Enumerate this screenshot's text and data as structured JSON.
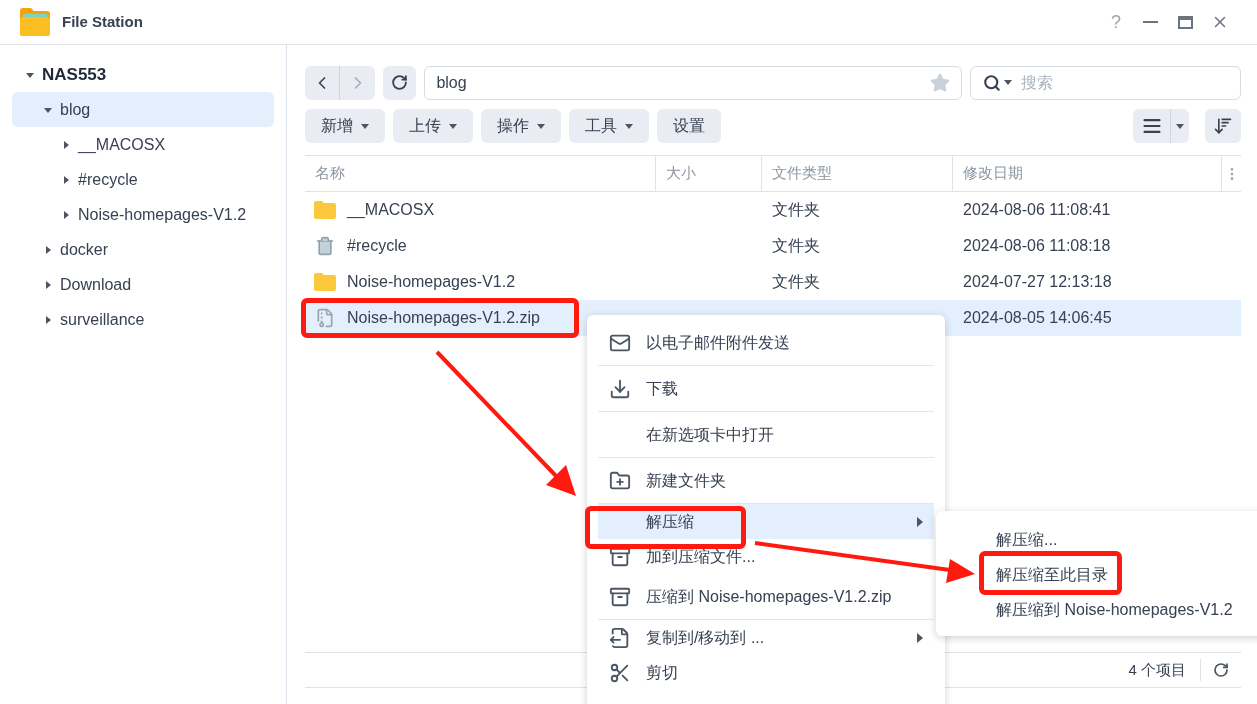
{
  "window": {
    "title": "File Station",
    "help": "?"
  },
  "sidebar": {
    "tree": [
      {
        "label": "NAS553",
        "expanded": true,
        "selected": false,
        "children": [
          {
            "label": "blog",
            "expanded": true,
            "selected": true,
            "children": [
              {
                "label": "__MACOSX",
                "expanded": false,
                "selected": false
              },
              {
                "label": "#recycle",
                "expanded": false,
                "selected": false
              },
              {
                "label": "Noise-homepages-V1.2",
                "expanded": false,
                "selected": false
              }
            ]
          },
          {
            "label": "docker",
            "expanded": false,
            "selected": false
          },
          {
            "label": "Download",
            "expanded": false,
            "selected": false
          },
          {
            "label": "surveillance",
            "expanded": false,
            "selected": false
          }
        ]
      }
    ]
  },
  "path": {
    "value": "blog",
    "starred": false
  },
  "search": {
    "placeholder": "搜索"
  },
  "toolbar": [
    {
      "label": "新增",
      "has_menu": true
    },
    {
      "label": "上传",
      "has_menu": true
    },
    {
      "label": "操作",
      "has_menu": true
    },
    {
      "label": "工具",
      "has_menu": true
    },
    {
      "label": "设置",
      "has_menu": false
    }
  ],
  "table": {
    "columns": [
      "名称",
      "大小",
      "文件类型",
      "修改日期"
    ],
    "rows": [
      {
        "kind": "folder",
        "name": "__MACOSX",
        "type": "文件夹",
        "modified": "2024-08-06 11:08:41",
        "selected": false
      },
      {
        "kind": "trash",
        "name": "#recycle",
        "type": "文件夹",
        "modified": "2024-08-06 11:08:18",
        "selected": false
      },
      {
        "kind": "folder",
        "name": "Noise-homepages-V1.2",
        "type": "文件夹",
        "modified": "2024-07-27 12:13:18",
        "selected": false
      },
      {
        "kind": "zip",
        "name": "Noise-homepages-V1.2.zip",
        "modified": "2024-08-05 14:06:45",
        "selected": true
      }
    ]
  },
  "status_bar": {
    "count": "4 个项目"
  },
  "context_menu": [
    {
      "kind": "mail",
      "label": "以电子邮件附件发送",
      "divider_after": true,
      "submenu": false,
      "highlighted": false
    },
    {
      "kind": "download",
      "label": "下载",
      "divider_after": true,
      "submenu": false,
      "highlighted": false
    },
    {
      "kind": "none",
      "label": "在新选项卡中打开",
      "divider_after": true,
      "submenu": false,
      "highlighted": false
    },
    {
      "kind": "new-folder",
      "label": "新建文件夹",
      "divider_after": true,
      "submenu": false,
      "highlighted": false
    },
    {
      "kind": "none",
      "label": "解压缩",
      "divider_after": false,
      "submenu": true,
      "highlighted": true
    },
    {
      "kind": "archive",
      "label": "加到压缩文件...",
      "divider_after": false,
      "submenu": false,
      "highlighted": false
    },
    {
      "kind": "archive",
      "label": "压缩到 Noise-homepages-V1.2.zip",
      "divider_after": true,
      "submenu": false,
      "highlighted": false
    },
    {
      "kind": "copy",
      "label": "复制到/移动到 ...",
      "divider_after": false,
      "submenu": true,
      "highlighted": false
    },
    {
      "kind": "cut",
      "label": "剪切",
      "divider_after": false,
      "submenu": false,
      "highlighted": false
    }
  ],
  "submenu": [
    "解压缩...",
    "解压缩至此目录",
    "解压缩到 Noise-homepages-V1.2"
  ]
}
